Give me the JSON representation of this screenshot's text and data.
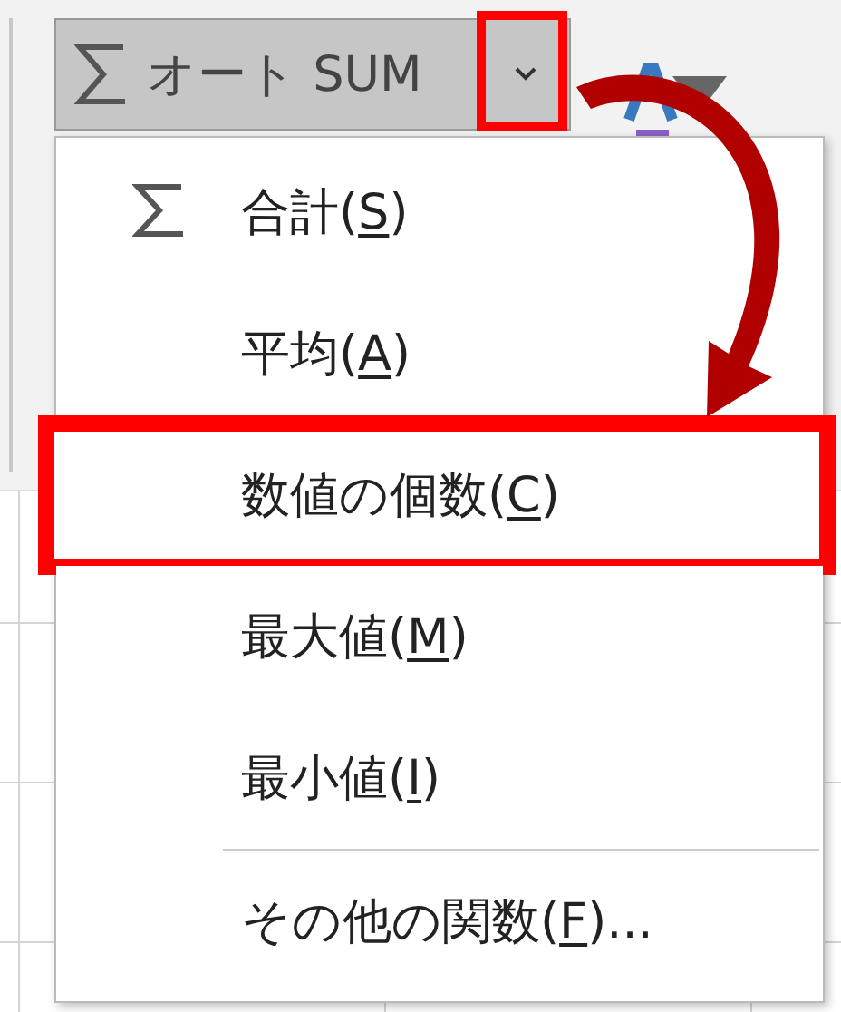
{
  "autosum_button": {
    "label": "オート SUM"
  },
  "menu": {
    "items": [
      {
        "kind": "icon",
        "prefix": "合計(",
        "key": "S",
        "suffix": ")",
        "highlighted": false
      },
      {
        "kind": "text",
        "prefix": "平均(",
        "key": "A",
        "suffix": ")",
        "highlighted": false
      },
      {
        "kind": "text",
        "prefix": "数値の個数(",
        "key": "C",
        "suffix": ")",
        "highlighted": true
      },
      {
        "kind": "text",
        "prefix": "最大値(",
        "key": "M",
        "suffix": ")",
        "highlighted": false
      },
      {
        "kind": "text",
        "prefix": "最小値(",
        "key": "I",
        "suffix": ")",
        "highlighted": false
      },
      {
        "kind": "separator"
      },
      {
        "kind": "text",
        "prefix": "その他の関数(",
        "key": "F",
        "suffix": ")...",
        "highlighted": false
      }
    ]
  }
}
